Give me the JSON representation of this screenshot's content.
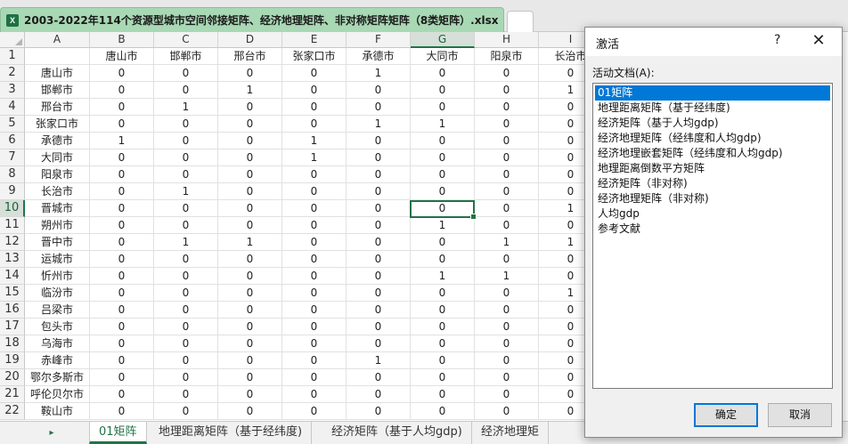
{
  "workbook": {
    "title": "2003-2022年114个资源型城市空间邻接矩阵、经济地理矩阵、非对称矩阵矩阵（8类矩阵）.xlsx",
    "icon": "excel-file-icon",
    "icon_glyph": "X"
  },
  "grid": {
    "columns": [
      "A",
      "B",
      "C",
      "D",
      "E",
      "F",
      "G",
      "H",
      "I"
    ],
    "selected_column": "G",
    "row_numbers": [
      "1",
      "2",
      "3",
      "4",
      "5",
      "6",
      "7",
      "8",
      "9",
      "10",
      "11",
      "12",
      "13",
      "14",
      "15",
      "16",
      "17",
      "18",
      "19",
      "20",
      "21",
      "22"
    ],
    "selected_row": "10",
    "header_row": [
      "",
      "唐山市",
      "邯郸市",
      "邢台市",
      "张家口市",
      "承德市",
      "大同市",
      "阳泉市",
      "长治市"
    ],
    "rows": [
      [
        "唐山市",
        "0",
        "0",
        "0",
        "0",
        "1",
        "0",
        "0",
        "0"
      ],
      [
        "邯郸市",
        "0",
        "0",
        "1",
        "0",
        "0",
        "0",
        "0",
        "1"
      ],
      [
        "邢台市",
        "0",
        "1",
        "0",
        "0",
        "0",
        "0",
        "0",
        "0"
      ],
      [
        "张家口市",
        "0",
        "0",
        "0",
        "0",
        "1",
        "1",
        "0",
        "0"
      ],
      [
        "承德市",
        "1",
        "0",
        "0",
        "1",
        "0",
        "0",
        "0",
        "0"
      ],
      [
        "大同市",
        "0",
        "0",
        "0",
        "1",
        "0",
        "0",
        "0",
        "0"
      ],
      [
        "阳泉市",
        "0",
        "0",
        "0",
        "0",
        "0",
        "0",
        "0",
        "0"
      ],
      [
        "长治市",
        "0",
        "1",
        "0",
        "0",
        "0",
        "0",
        "0",
        "0"
      ],
      [
        "晋城市",
        "0",
        "0",
        "0",
        "0",
        "0",
        "0",
        "0",
        "1"
      ],
      [
        "朔州市",
        "0",
        "0",
        "0",
        "0",
        "0",
        "1",
        "0",
        "0"
      ],
      [
        "晋中市",
        "0",
        "1",
        "1",
        "0",
        "0",
        "0",
        "1",
        "1"
      ],
      [
        "运城市",
        "0",
        "0",
        "0",
        "0",
        "0",
        "0",
        "0",
        "0"
      ],
      [
        "忻州市",
        "0",
        "0",
        "0",
        "0",
        "0",
        "1",
        "1",
        "0"
      ],
      [
        "临汾市",
        "0",
        "0",
        "0",
        "0",
        "0",
        "0",
        "0",
        "1"
      ],
      [
        "吕梁市",
        "0",
        "0",
        "0",
        "0",
        "0",
        "0",
        "0",
        "0"
      ],
      [
        "包头市",
        "0",
        "0",
        "0",
        "0",
        "0",
        "0",
        "0",
        "0"
      ],
      [
        "乌海市",
        "0",
        "0",
        "0",
        "0",
        "0",
        "0",
        "0",
        "0"
      ],
      [
        "赤峰市",
        "0",
        "0",
        "0",
        "0",
        "1",
        "0",
        "0",
        "0"
      ],
      [
        "鄂尔多斯市",
        "0",
        "0",
        "0",
        "0",
        "0",
        "0",
        "0",
        "0"
      ],
      [
        "呼伦贝尔市",
        "0",
        "0",
        "0",
        "0",
        "0",
        "0",
        "0",
        "0"
      ],
      [
        "鞍山市",
        "0",
        "0",
        "0",
        "0",
        "0",
        "0",
        "0",
        "0"
      ]
    ]
  },
  "sheet_tabs": [
    "01矩阵",
    "地理距离矩阵（基于经纬度)",
    "经济矩阵（基于人均gdp)",
    "经济地理矩"
  ],
  "sheet_nav_icon": "play-arrow-icon",
  "sheet_nav_glyph": "▸",
  "dialog": {
    "title": "激活",
    "help": "?",
    "close_glyph": "✕",
    "label": "活动文档(A):",
    "items": [
      "01矩阵",
      "地理距离矩阵（基于经纬度)",
      "经济矩阵（基于人均gdp)",
      "经济地理矩阵（经纬度和人均gdp)",
      "经济地理嵌套矩阵（经纬度和人均gdp)",
      "地理距离倒数平方矩阵",
      "经济矩阵（非对称)",
      "经济地理矩阵（非对称)",
      "人均gdp",
      "参考文献"
    ],
    "selected_index": 0,
    "ok": "确定",
    "cancel": "取消"
  },
  "colors": {
    "accent": "#217346",
    "selection": "#0078d7",
    "workbook_tab": "#a8d8b4"
  }
}
